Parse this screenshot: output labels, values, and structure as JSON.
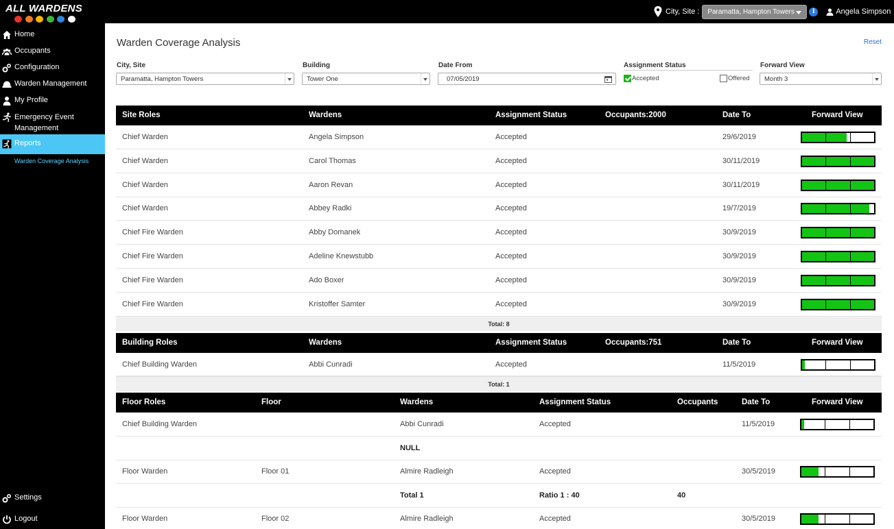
{
  "app": {
    "logo_text": "ALL WARDENS",
    "helmet_colors": [
      "#e8322b",
      "#f07b1f",
      "#f4b400",
      "#3cb53c",
      "#2e86de",
      "#ffffff"
    ]
  },
  "topbar": {
    "location_label": "City, Site :",
    "site_value": "Paramatta, Hampton Towers",
    "info_icon": "i",
    "user_name": "Angela Simpson"
  },
  "sidebar": {
    "items": [
      {
        "label": "Home",
        "icon": "home-icon"
      },
      {
        "label": "Occupants",
        "icon": "users-icon"
      },
      {
        "label": "Configuration",
        "icon": "gears-icon"
      },
      {
        "label": "Warden Management",
        "icon": "helmet-icon"
      },
      {
        "label": "My Profile",
        "icon": "user-icon"
      },
      {
        "label": "Emergency Event Management",
        "icon": "running-man-icon"
      },
      {
        "label": "Reports",
        "icon": "report-icon"
      }
    ],
    "sub_item": "Warden Coverage Analysis",
    "bottom": [
      {
        "label": "Settings",
        "icon": "gears-icon"
      },
      {
        "label": "Logout",
        "icon": "power-icon"
      }
    ]
  },
  "page": {
    "title": "Warden Coverage Analysis",
    "reset": "Reset"
  },
  "filters": {
    "city_site": {
      "label": "City, Site",
      "value": "Paramatta, Hampton Towers"
    },
    "building": {
      "label": "Building",
      "value": "Tower One"
    },
    "date_from": {
      "label": "Date From",
      "value": "07/05/2019"
    },
    "assignment_status": {
      "label": "Assignment Status",
      "accepted": "Accepted",
      "offered": "Offered",
      "accepted_checked": true,
      "offered_checked": false
    },
    "forward_view": {
      "label": "Forward View",
      "value": "Month 3"
    }
  },
  "site_table": {
    "headers": [
      "Site Roles",
      "Wardens",
      "Assignment Status",
      "Occupants:2000",
      "Date To",
      "Forward View"
    ],
    "rows": [
      {
        "role": "Chief Warden",
        "warden": "Angela Simpson",
        "status": "Accepted",
        "date_to": "29/6/2019",
        "coverage": 0.62
      },
      {
        "role": "Chief Warden",
        "warden": "Carol Thomas",
        "status": "Accepted",
        "date_to": "30/11/2019",
        "coverage": 1.0
      },
      {
        "role": "Chief Warden",
        "warden": "Aaron Revan",
        "status": "Accepted",
        "date_to": "30/11/2019",
        "coverage": 1.0
      },
      {
        "role": "Chief Warden",
        "warden": "Abbey Radki",
        "status": "Accepted",
        "date_to": "19/7/2019",
        "coverage": 0.93
      },
      {
        "role": "Chief Fire Warden",
        "warden": "Abby Domanek",
        "status": "Accepted",
        "date_to": "30/9/2019",
        "coverage": 1.0
      },
      {
        "role": "Chief Fire Warden",
        "warden": "Adeline Knewstubb",
        "status": "Accepted",
        "date_to": "30/9/2019",
        "coverage": 1.0
      },
      {
        "role": "Chief Fire Warden",
        "warden": "Ado Boxer",
        "status": "Accepted",
        "date_to": "30/9/2019",
        "coverage": 1.0
      },
      {
        "role": "Chief Fire Warden",
        "warden": "Kristoffer Samter",
        "status": "Accepted",
        "date_to": "30/9/2019",
        "coverage": 1.0
      }
    ],
    "total": "Total: 8"
  },
  "building_table": {
    "headers": [
      "Building Roles",
      "Wardens",
      "Assignment Status",
      "Occupants:751",
      "Date To",
      "Forward View"
    ],
    "rows": [
      {
        "role": "Chief Building Warden",
        "warden": "Abbi Cunradi",
        "status": "Accepted",
        "date_to": "11/5/2019",
        "coverage": 0.04
      }
    ],
    "total": "Total: 1"
  },
  "floor_table": {
    "headers": [
      "Floor Roles",
      "Floor",
      "Wardens",
      "Assignment Status",
      "Occupants",
      "Date To",
      "Forward View"
    ],
    "rows": [
      {
        "role": "Chief Building Warden",
        "floor": "",
        "warden": "Abbi Cunradi",
        "status": "Accepted",
        "occupants": "",
        "date_to": "11/5/2019",
        "coverage": 0.04
      },
      {
        "summary": true,
        "warden": "NULL",
        "status": "",
        "occupants": ""
      },
      {
        "role": "Floor Warden",
        "floor": "Floor 01",
        "warden": "Almire Radleigh",
        "status": "Accepted",
        "occupants": "",
        "date_to": "30/5/2019",
        "coverage": 0.24
      },
      {
        "summary": true,
        "warden": "Total 1",
        "status": "Ratio 1 : 40",
        "occupants": "40"
      },
      {
        "role": "Floor Warden",
        "floor": "Floor 02",
        "warden": "Almire Radleigh",
        "status": "Accepted",
        "occupants": "",
        "date_to": "30/5/2019",
        "coverage": 0.24
      }
    ]
  }
}
